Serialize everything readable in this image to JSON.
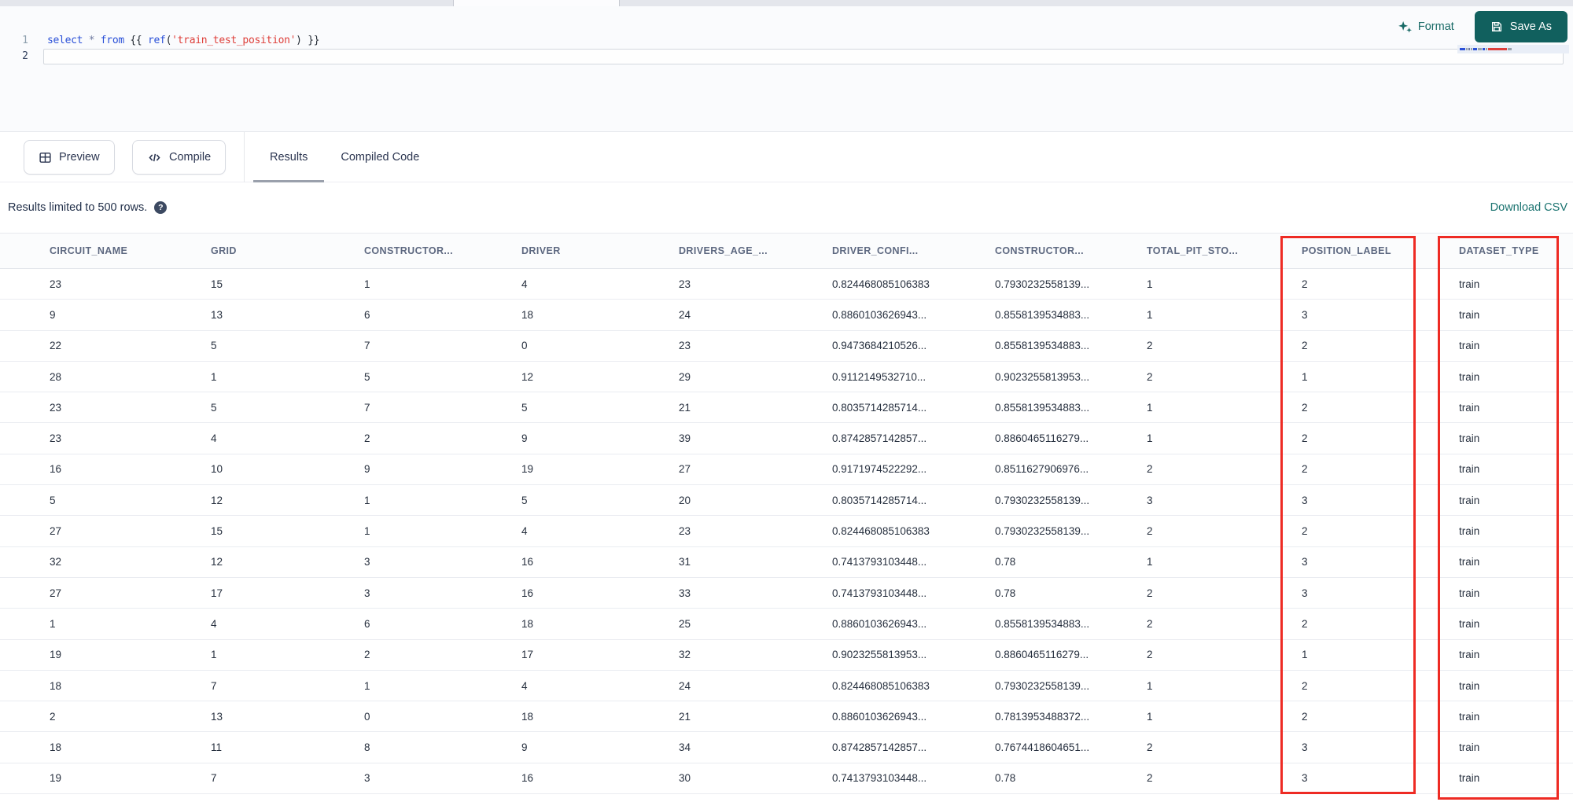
{
  "editor": {
    "line_numbers": [
      "1",
      "2"
    ],
    "code_tokens": [
      {
        "text": "select",
        "type": "keyword"
      },
      {
        "text": " ",
        "type": "plain"
      },
      {
        "text": "*",
        "type": "operator"
      },
      {
        "text": " ",
        "type": "plain"
      },
      {
        "text": "from",
        "type": "keyword"
      },
      {
        "text": " {{ ",
        "type": "plain"
      },
      {
        "text": "ref",
        "type": "keyword"
      },
      {
        "text": "(",
        "type": "plain"
      },
      {
        "text": "'train_test_position'",
        "type": "string"
      },
      {
        "text": ") }}",
        "type": "plain"
      }
    ],
    "format_label": "Format",
    "save_as_label": "Save As"
  },
  "toolbar": {
    "preview_label": "Preview",
    "compile_label": "Compile",
    "tabs": [
      {
        "label": "Results",
        "active": true
      },
      {
        "label": "Compiled Code",
        "active": false
      }
    ]
  },
  "results_bar": {
    "limit_text": "Results limited to 500 rows.",
    "help_icon": "question-mark-icon",
    "download_label": "Download CSV"
  },
  "table": {
    "columns": [
      "CIRCUIT_NAME",
      "GRID",
      "CONSTRUCTOR...",
      "DRIVER",
      "DRIVERS_AGE_...",
      "DRIVER_CONFI...",
      "CONSTRUCTOR...",
      "TOTAL_PIT_STO...",
      "POSITION_LABEL",
      "DATASET_TYPE"
    ],
    "highlighted_columns": [
      "POSITION_LABEL",
      "DATASET_TYPE"
    ],
    "rows": [
      [
        "23",
        "15",
        "1",
        "4",
        "23",
        "0.824468085106383",
        "0.7930232558139...",
        "1",
        "2",
        "train"
      ],
      [
        "9",
        "13",
        "6",
        "18",
        "24",
        "0.8860103626943...",
        "0.8558139534883...",
        "1",
        "3",
        "train"
      ],
      [
        "22",
        "5",
        "7",
        "0",
        "23",
        "0.9473684210526...",
        "0.8558139534883...",
        "2",
        "2",
        "train"
      ],
      [
        "28",
        "1",
        "5",
        "12",
        "29",
        "0.9112149532710...",
        "0.9023255813953...",
        "2",
        "1",
        "train"
      ],
      [
        "23",
        "5",
        "7",
        "5",
        "21",
        "0.8035714285714...",
        "0.8558139534883...",
        "1",
        "2",
        "train"
      ],
      [
        "23",
        "4",
        "2",
        "9",
        "39",
        "0.8742857142857...",
        "0.8860465116279...",
        "1",
        "2",
        "train"
      ],
      [
        "16",
        "10",
        "9",
        "19",
        "27",
        "0.9171974522292...",
        "0.8511627906976...",
        "2",
        "2",
        "train"
      ],
      [
        "5",
        "12",
        "1",
        "5",
        "20",
        "0.8035714285714...",
        "0.7930232558139...",
        "3",
        "3",
        "train"
      ],
      [
        "27",
        "15",
        "1",
        "4",
        "23",
        "0.824468085106383",
        "0.7930232558139...",
        "2",
        "2",
        "train"
      ],
      [
        "32",
        "12",
        "3",
        "16",
        "31",
        "0.7413793103448...",
        "0.78",
        "1",
        "3",
        "train"
      ],
      [
        "27",
        "17",
        "3",
        "16",
        "33",
        "0.7413793103448...",
        "0.78",
        "2",
        "3",
        "train"
      ],
      [
        "1",
        "4",
        "6",
        "18",
        "25",
        "0.8860103626943...",
        "0.8558139534883...",
        "2",
        "2",
        "train"
      ],
      [
        "19",
        "1",
        "2",
        "17",
        "32",
        "0.9023255813953...",
        "0.8860465116279...",
        "2",
        "1",
        "train"
      ],
      [
        "18",
        "7",
        "1",
        "4",
        "24",
        "0.824468085106383",
        "0.7930232558139...",
        "1",
        "2",
        "train"
      ],
      [
        "2",
        "13",
        "0",
        "18",
        "21",
        "0.8860103626943...",
        "0.7813953488372...",
        "1",
        "2",
        "train"
      ],
      [
        "18",
        "11",
        "8",
        "9",
        "34",
        "0.8742857142857...",
        "0.7674418604651...",
        "2",
        "3",
        "train"
      ],
      [
        "19",
        "7",
        "3",
        "16",
        "30",
        "0.7413793103448...",
        "0.78",
        "2",
        "3",
        "train"
      ]
    ]
  },
  "colors": {
    "accent_teal": "#11605e",
    "link_teal": "#1b7370",
    "annotation_red": "#ee2b24",
    "keyword_blue": "#2b51d8",
    "string_red": "#de403b"
  }
}
